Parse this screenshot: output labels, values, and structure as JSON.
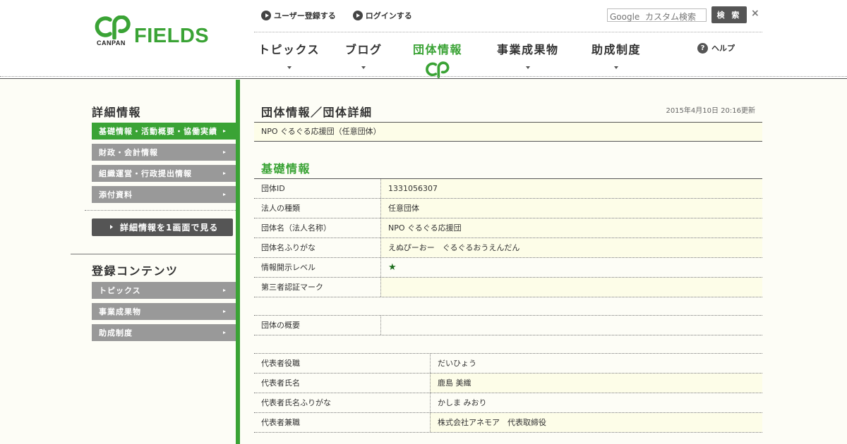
{
  "header": {
    "logo_sub": "CANPAN",
    "logo_main": "FIELDS",
    "top_links": [
      {
        "label": "ユーザー登録する"
      },
      {
        "label": "ログインする"
      }
    ],
    "search": {
      "placeholder": "Google  カスタム検索",
      "button_label": "検 索",
      "close_label": "×"
    },
    "nav": [
      {
        "label": "トピックス"
      },
      {
        "label": "ブログ"
      },
      {
        "label": "団体情報"
      },
      {
        "label": "事業成果物"
      },
      {
        "label": "助成制度"
      }
    ],
    "help_label": "ヘルプ",
    "accent_color": "#3aa335"
  },
  "sidebar": {
    "detail_heading": "詳細情報",
    "detail_items": [
      {
        "label": "基礎情報・活動概要・協働実績",
        "active": true
      },
      {
        "label": "財政・会計情報",
        "active": false
      },
      {
        "label": "組織運営・行政提出情報",
        "active": false
      },
      {
        "label": "添付資料",
        "active": false
      }
    ],
    "one_page_button": "詳細情報を1画面で見る",
    "content_heading": "登録コンテンツ",
    "content_items": [
      {
        "label": "トピックス"
      },
      {
        "label": "事業成果物"
      },
      {
        "label": "助成制度"
      }
    ]
  },
  "main": {
    "page_title": "団体情報／団体詳細",
    "updated": "2015年4月10日 20:16更新",
    "org_name": "NPO ぐるぐる応援団（任意団体）",
    "section_title": "基礎情報",
    "basic_rows": [
      {
        "label": "団体ID",
        "value": "1331056307"
      },
      {
        "label": "法人の種類",
        "value": "任意団体"
      },
      {
        "label": "団体名（法人名称）",
        "value": "NPO ぐるぐる応援団"
      },
      {
        "label": "団体名ふりがな",
        "value": "えぬぴーおー　ぐるぐるおうえんだん"
      },
      {
        "label": "情報開示レベル",
        "value": "★"
      },
      {
        "label": "第三者認証マーク",
        "value": ""
      }
    ],
    "overview_row": {
      "label": "団体の概要",
      "value": ""
    },
    "rep_rows": [
      {
        "label": "代表者役職",
        "value": "だいひょう"
      },
      {
        "label": "代表者氏名",
        "value": "鹿島 美織"
      },
      {
        "label": "代表者氏名ふりがな",
        "value": "かしま みおり"
      },
      {
        "label": "代表者兼職",
        "value": "株式会社アネモア　代表取締役"
      }
    ]
  }
}
